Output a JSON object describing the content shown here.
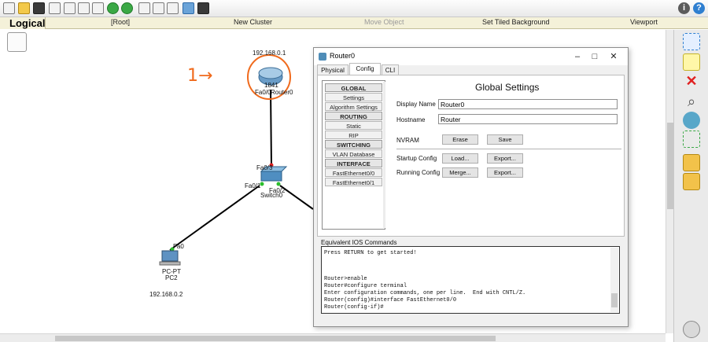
{
  "nav": {
    "logical_tab": "Logical",
    "root": "[Root]",
    "new_cluster": "New Cluster",
    "move_object": "Move Object",
    "set_tiled_background": "Set Tiled Background",
    "viewport": "Viewport"
  },
  "workspace": {
    "router_ip": "192.168.0.1",
    "router_model": "1841",
    "router_name": "Router0",
    "router_port": "Fa0/0",
    "switch_name": "Switch0",
    "switch_port_up": "Fa0/3",
    "switch_port_left": "Fa0/1",
    "switch_port_right": "Fa0/2",
    "pc_port": "Fa0",
    "pc_type": "PC-PT",
    "pc_name": "PC2",
    "pc_ip": "192.168.0.2",
    "annotation": "1→"
  },
  "dialog": {
    "title": "Router0",
    "tabs": [
      "Physical",
      "Config",
      "CLI"
    ],
    "active_tab": "Config",
    "left_nav": {
      "global_header": "GLOBAL",
      "settings": "Settings",
      "algorithm_settings": "Algorithm Settings",
      "routing_header": "ROUTING",
      "static": "Static",
      "rip": "RIP",
      "switching_header": "SWITCHING",
      "vlan_database": "VLAN Database",
      "interface_header": "INTERFACE",
      "fe00": "FastEthernet0/0",
      "fe01": "FastEthernet0/1"
    },
    "global_settings": {
      "heading": "Global Settings",
      "display_name_label": "Display Name",
      "display_name_value": "Router0",
      "hostname_label": "Hostname",
      "hostname_value": "Router",
      "nvram_label": "NVRAM",
      "erase": "Erase",
      "save": "Save",
      "startup_config_label": "Startup Config",
      "startup_load": "Load...",
      "startup_export": "Export...",
      "running_config_label": "Running Config",
      "running_merge": "Merge...",
      "running_export": "Export..."
    },
    "equivalent_label": "Equivalent IOS Commands",
    "console_lines": [
      "Press RETURN to get started!",
      "",
      "",
      "",
      "",
      "Router>enable",
      "Router#configure terminal",
      "Enter configuration commands, one per line.  End with CNTL/Z.",
      "Router(config)#interface FastEthernet0/0",
      "Router(config-if)#"
    ]
  }
}
